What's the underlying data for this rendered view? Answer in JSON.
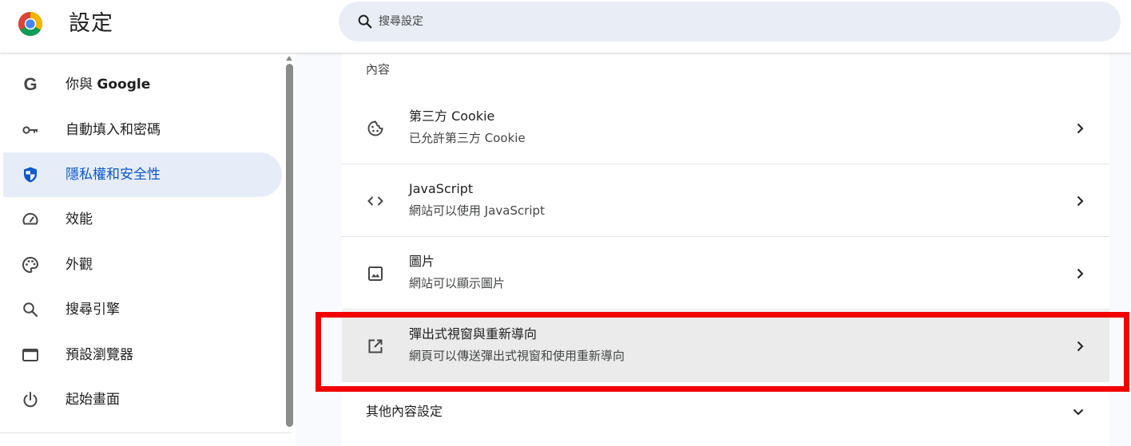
{
  "header": {
    "title": "設定",
    "logo_icon": "chrome-logo-icon",
    "search": {
      "placeholder": "搜尋設定",
      "value": ""
    }
  },
  "sidebar": {
    "items": [
      {
        "label_prefix": "你與 ",
        "label_bold": "Google",
        "icon": "google-g-icon",
        "active": false
      },
      {
        "label": "自動填入和密碼",
        "icon": "key-icon",
        "active": false
      },
      {
        "label": "隱私權和安全性",
        "icon": "shield-icon",
        "active": true
      },
      {
        "label": "效能",
        "icon": "speedometer-icon",
        "active": false
      },
      {
        "label": "外觀",
        "icon": "palette-icon",
        "active": false
      },
      {
        "label": "搜尋引擎",
        "icon": "search-icon",
        "active": false
      },
      {
        "label": "預設瀏覽器",
        "icon": "browser-window-icon",
        "active": false
      },
      {
        "label": "起始畫面",
        "icon": "power-icon",
        "active": false
      }
    ]
  },
  "content": {
    "section_title": "內容",
    "rows": [
      {
        "title": "第三方 Cookie",
        "subtitle": "已允許第三方 Cookie",
        "icon": "cookie-icon"
      },
      {
        "title": "JavaScript",
        "subtitle": "網站可以使用 JavaScript",
        "icon": "code-icon"
      },
      {
        "title": "圖片",
        "subtitle": "網站可以顯示圖片",
        "icon": "image-icon"
      },
      {
        "title": "彈出式視窗與重新導向",
        "subtitle": "網頁可以傳送彈出式視窗和使用重新導向",
        "icon": "open-in-new-icon"
      }
    ],
    "other_settings_label": "其他內容設定"
  },
  "colors": {
    "accent": "#0b57d0",
    "active_bg": "#e7edf8",
    "highlight_border": "#f20000"
  }
}
